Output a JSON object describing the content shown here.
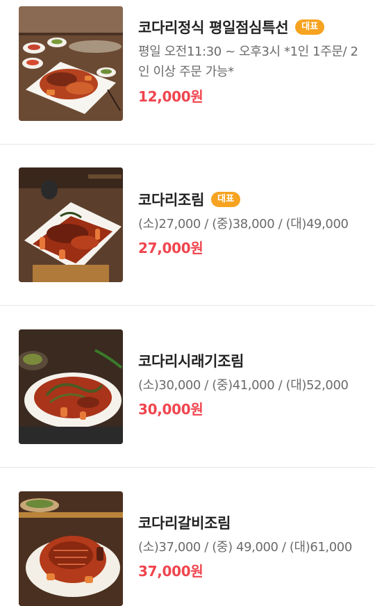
{
  "menu": {
    "items": [
      {
        "name": "코다리정식 평일점심특선",
        "badge": "대표",
        "description": "평일 오전11:30 ~ 오후3시 *1인 1주문/ 2인 이상 주문 가능*",
        "price": "12,000원",
        "image": "kodari-set-meal-photo"
      },
      {
        "name": "코다리조림",
        "badge": "대표",
        "description": "(소)27,000 / (중)38,000 / (대)49,000",
        "price": "27,000원",
        "image": "braised-kodari-photo"
      },
      {
        "name": "코다리시래기조림",
        "badge": "",
        "description": "(소)30,000 / (중)41,000 / (대)52,000",
        "price": "30,000원",
        "image": "braised-kodari-siraegi-photo"
      },
      {
        "name": "코다리갈비조림",
        "badge": "",
        "description": "(소)37,000 / (중) 49,000 / (대)61,000",
        "price": "37,000원",
        "image": "braised-kodari-galbi-photo"
      }
    ]
  },
  "colors": {
    "badge": "#f6a321",
    "price": "#f0454e",
    "title": "#222222",
    "description": "#6b6b6b",
    "divider": "#e6e6e6"
  }
}
